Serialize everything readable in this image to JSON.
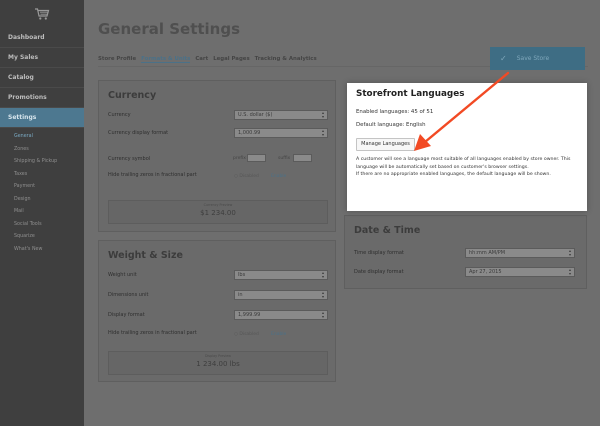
{
  "sidebar": {
    "logo_icon": "shopping-cart-icon",
    "items": [
      {
        "label": "Dashboard"
      },
      {
        "label": "My Sales"
      },
      {
        "label": "Catalog"
      },
      {
        "label": "Promotions"
      },
      {
        "label": "Settings"
      }
    ],
    "subitems": [
      {
        "label": "General"
      },
      {
        "label": "Zones"
      },
      {
        "label": "Shipping & Pickup"
      },
      {
        "label": "Taxes"
      },
      {
        "label": "Payment"
      },
      {
        "label": "Design"
      },
      {
        "label": "Mail"
      },
      {
        "label": "Social Tools"
      },
      {
        "label": "Squarize"
      },
      {
        "label": "What's New"
      }
    ]
  },
  "header": {
    "title": "General Settings",
    "save_label": "Save Store",
    "tabs": [
      {
        "label": "Store Profile"
      },
      {
        "label": "Formats & Units"
      },
      {
        "label": "Cart"
      },
      {
        "label": "Legal Pages"
      },
      {
        "label": "Tracking & Analytics"
      }
    ]
  },
  "currency": {
    "title": "Currency",
    "currency_label": "Currency",
    "currency_value": "U.S. dollar ($)",
    "display_format_label": "Currency display format",
    "display_format_value": "1,000.99",
    "symbol_label": "Currency symbol",
    "prefix_label": "prefix",
    "suffix_label": "suffix",
    "hide_zeros_label": "Hide trailing zeros in fractional part",
    "disabled_text": "Disabled",
    "enable_link": "Enable",
    "preview_caption": "Currency Preview",
    "preview_value": "$1 234.00"
  },
  "weight": {
    "title": "Weight & Size",
    "weight_unit_label": "Weight unit",
    "weight_unit_value": "lbs",
    "dimensions_unit_label": "Dimensions unit",
    "dimensions_unit_value": "in",
    "display_format_label": "Display format",
    "display_format_value": "1,999.99",
    "hide_zeros_label": "Hide trailing zeros in fractional part",
    "disabled_text": "Disabled",
    "enable_link": "Enable",
    "preview_caption": "Display Preview",
    "preview_value": "1 234.00 lbs"
  },
  "datetime": {
    "title": "Date & Time",
    "time_format_label": "Time display format",
    "time_format_value": "hh:mm AM/PM",
    "date_format_label": "Date display format",
    "date_format_value": "Apr 27, 2015"
  },
  "popover": {
    "title": "Storefront Languages",
    "enabled_languages": "Enabled languages: 45 of 51",
    "default_language": "Default language: English",
    "manage_button": "Manage Languages",
    "description_1": "A customer will see a language most suitable of all languages enabled by store owner. This language will be automatically set based on customer's browser settings.",
    "description_2": "If there are no appropriate enabled languages, the default language will be shown."
  },
  "colors": {
    "annotation_arrow": "#f24a24",
    "accent": "#4b7188"
  }
}
